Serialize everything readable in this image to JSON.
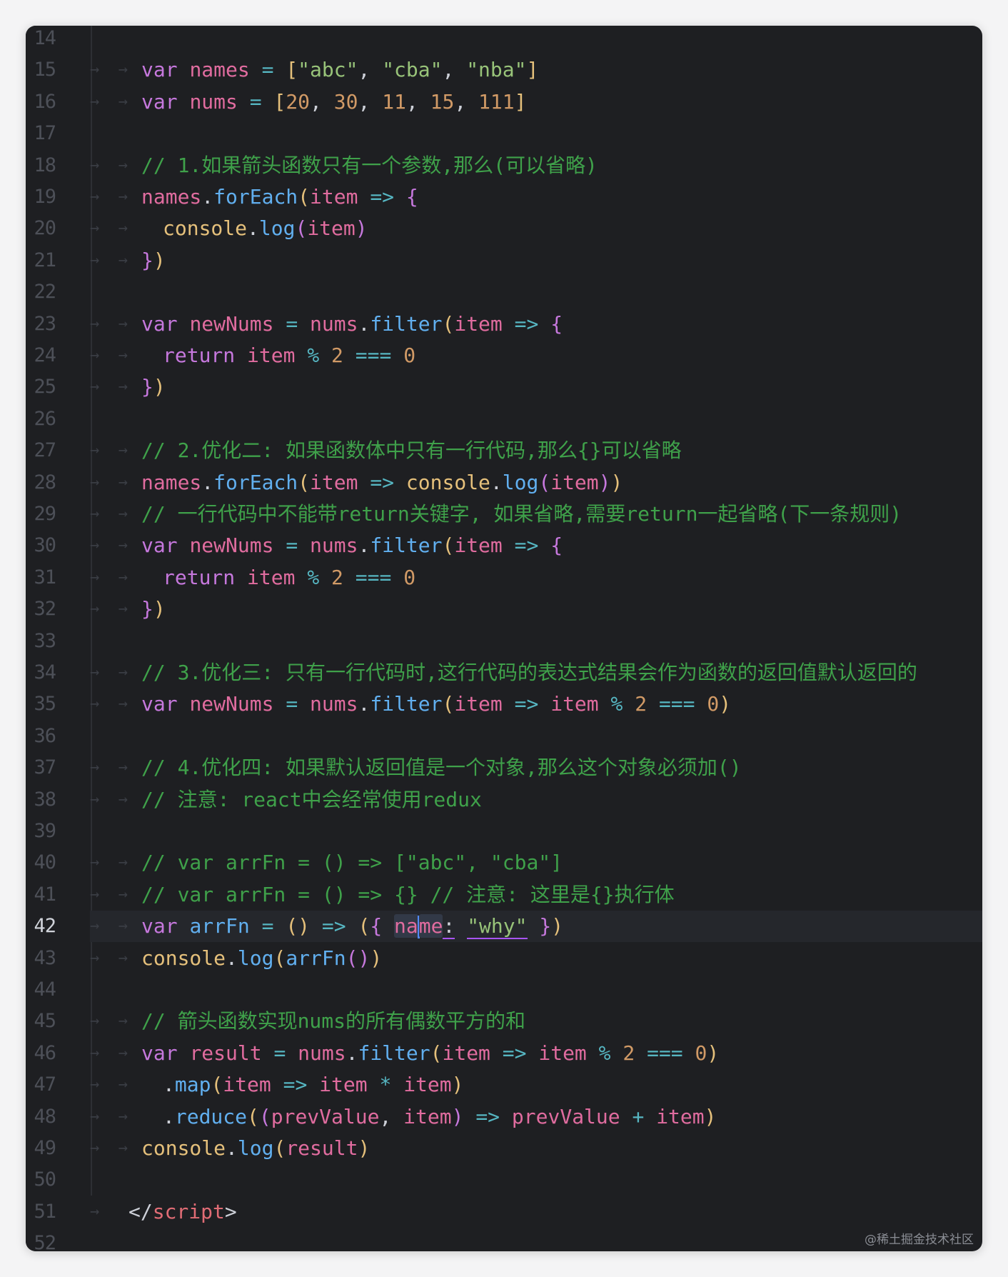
{
  "editor": {
    "current_line": 42,
    "watermark": "@稀土掘金技术社区",
    "line_numbers": [
      "14",
      "15",
      "16",
      "17",
      "18",
      "19",
      "20",
      "21",
      "22",
      "23",
      "24",
      "25",
      "26",
      "27",
      "28",
      "29",
      "30",
      "31",
      "32",
      "33",
      "34",
      "35",
      "36",
      "37",
      "38",
      "39",
      "40",
      "41",
      "42",
      "43",
      "44",
      "45",
      "46",
      "47",
      "48",
      "49",
      "50",
      "51",
      "52"
    ],
    "lines": {
      "l15": [
        "var",
        "names",
        "=",
        "[",
        "\"abc\"",
        ",",
        "\"cba\"",
        ",",
        "\"nba\"",
        "]"
      ],
      "l16": [
        "var",
        "nums",
        "=",
        "[",
        "20",
        ",",
        "30",
        ",",
        "11",
        ",",
        "15",
        ",",
        "111",
        "]"
      ],
      "l18": "// 1.如果箭头函数只有一个参数,那么(可以省略)",
      "l19": [
        "names",
        ".",
        "forEach",
        "(",
        "item",
        "=>",
        "{"
      ],
      "l20": [
        "console",
        ".",
        "log",
        "(",
        "item",
        ")"
      ],
      "l21": [
        "}",
        ")"
      ],
      "l23": [
        "var",
        "newNums",
        "=",
        "nums",
        ".",
        "filter",
        "(",
        "item",
        "=>",
        "{"
      ],
      "l24": [
        "return",
        "item",
        "%",
        "2",
        "===",
        "0"
      ],
      "l25": [
        "}",
        ")"
      ],
      "l27": "// 2.优化二: 如果函数体中只有一行代码,那么{}可以省略",
      "l28": [
        "names",
        ".",
        "forEach",
        "(",
        "item",
        "=>",
        "console",
        ".",
        "log",
        "(",
        "item",
        ")",
        ")"
      ],
      "l29": "// 一行代码中不能带return关键字, 如果省略,需要return一起省略(下一条规则)",
      "l30": [
        "var",
        "newNums",
        "=",
        "nums",
        ".",
        "filter",
        "(",
        "item",
        "=>",
        "{"
      ],
      "l31": [
        "return",
        "item",
        "%",
        "2",
        "===",
        "0"
      ],
      "l32": [
        "}",
        ")"
      ],
      "l34": "// 3.优化三: 只有一行代码时,这行代码的表达式结果会作为函数的返回值默认返回的",
      "l35": [
        "var",
        "newNums",
        "=",
        "nums",
        ".",
        "filter",
        "(",
        "item",
        "=>",
        "item",
        "%",
        "2",
        "===",
        "0",
        ")"
      ],
      "l37": "// 4.优化四: 如果默认返回值是一个对象,那么这个对象必须加()",
      "l38": "// 注意: react中会经常使用redux",
      "l40": "// var arrFn = () => [\"abc\", \"cba\"]",
      "l41": "// var arrFn = () => {} // 注意: 这里是{}执行体",
      "l42": [
        "var",
        "arrFn",
        "=",
        "(",
        ")",
        "=>",
        "(",
        "{",
        "na",
        "me",
        ":",
        "\"why\"",
        "}",
        ")"
      ],
      "l43": [
        "console",
        ".",
        "log",
        "(",
        "arrFn",
        "(",
        ")",
        ")"
      ],
      "l45": "// 箭头函数实现nums的所有偶数平方的和",
      "l46": [
        "var",
        "result",
        "=",
        "nums",
        ".",
        "filter",
        "(",
        "item",
        "=>",
        "item",
        "%",
        "2",
        "===",
        "0",
        ")"
      ],
      "l47": [
        ".",
        "map",
        "(",
        "item",
        "=>",
        "item",
        "*",
        "item",
        ")"
      ],
      "l48": [
        ".",
        "reduce",
        "(",
        "(",
        "prevValue",
        ",",
        "item",
        ")",
        "=>",
        "prevValue",
        "+",
        "item",
        ")"
      ],
      "l49": [
        "console",
        ".",
        "log",
        "(",
        "result",
        ")"
      ],
      "l51": [
        "</",
        "script",
        ">"
      ]
    },
    "indent_marker": "→"
  }
}
